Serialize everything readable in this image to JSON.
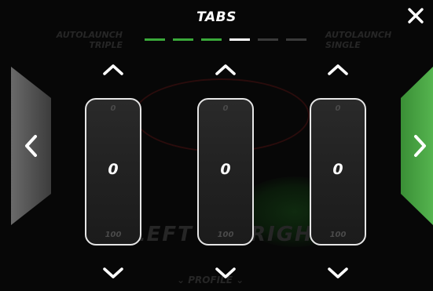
{
  "header": {
    "title": "TABS",
    "pages": [
      {
        "state": "done"
      },
      {
        "state": "done"
      },
      {
        "state": "done"
      },
      {
        "state": "current"
      },
      {
        "state": "upcoming"
      },
      {
        "state": "upcoming"
      }
    ]
  },
  "background": {
    "autolaunch_triple": "AUTOLAUNCH TRIPLE",
    "autolaunch_single": "AUTOLAUNCH SINGLE",
    "left_label": "LEFT",
    "right_label": "RIGHT",
    "profile_label": "PROFILE"
  },
  "columns": [
    {
      "value": "0",
      "max_label": "0",
      "min_label": "100"
    },
    {
      "value": "0",
      "max_label": "0",
      "min_label": "100"
    },
    {
      "value": "0",
      "max_label": "0",
      "min_label": "100"
    }
  ],
  "icons": {
    "close": "close-icon",
    "prev": "chevron-left-icon",
    "next": "chevron-right-icon",
    "up": "chevron-up-icon",
    "down": "chevron-down-icon"
  },
  "colors": {
    "page_done": "#3aa93a",
    "page_current": "#ffffff",
    "page_upcoming": "#3a3a3a",
    "nav_next": "#43a23f",
    "nav_prev": "#5a5a5a"
  }
}
